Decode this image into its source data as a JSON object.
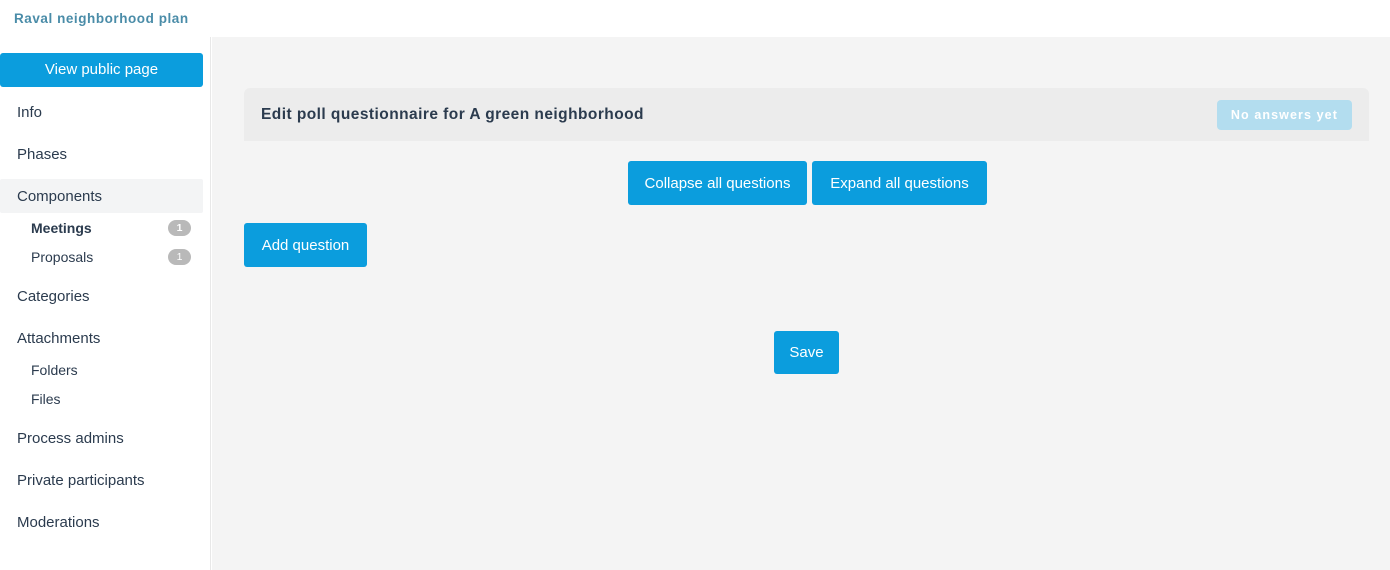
{
  "topbar": {
    "title": "Raval neighborhood plan"
  },
  "sidebar": {
    "public_page_button": "View public page",
    "items": [
      {
        "label": "Info",
        "type": "top",
        "badge": null,
        "active": false
      },
      {
        "label": "Phases",
        "type": "top",
        "badge": null,
        "active": false
      },
      {
        "label": "Components",
        "type": "top",
        "badge": null,
        "active": true
      },
      {
        "label": "Meetings",
        "type": "sub",
        "badge": "1",
        "active": true
      },
      {
        "label": "Proposals",
        "type": "sub",
        "badge": "1",
        "active": false
      },
      {
        "label": "Categories",
        "type": "top",
        "badge": null,
        "active": false
      },
      {
        "label": "Attachments",
        "type": "top",
        "badge": null,
        "active": false
      },
      {
        "label": "Folders",
        "type": "sub",
        "badge": null,
        "active": false
      },
      {
        "label": "Files",
        "type": "sub",
        "badge": null,
        "active": false
      },
      {
        "label": "Process admins",
        "type": "top",
        "badge": null,
        "active": false
      },
      {
        "label": "Private participants",
        "type": "top",
        "badge": null,
        "active": false
      },
      {
        "label": "Moderations",
        "type": "top",
        "badge": null,
        "active": false
      }
    ]
  },
  "main": {
    "card_title": "Edit poll questionnaire for A green neighborhood",
    "answers_badge": "No answers yet",
    "collapse_all_label": "Collapse all questions",
    "expand_all_label": "Expand all questions",
    "add_question_label": "Add question",
    "save_label": "Save"
  },
  "colors": {
    "accent_blue": "#0b9ddd",
    "badge_disabled_blue": "#b3ddef",
    "title_teal": "#4a8ca8",
    "page_background": "#f4f4f4",
    "card_header": "#ececec",
    "text_dark": "#2b3b4e",
    "count_badge_gray": "#b9b9b9"
  }
}
